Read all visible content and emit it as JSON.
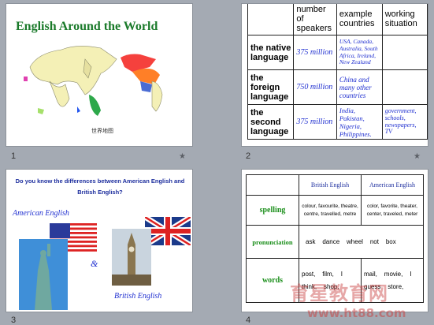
{
  "slides": [
    {
      "number": "1",
      "title": "English Around the World",
      "map_caption": "世界地图"
    },
    {
      "number": "2",
      "headers": [
        "",
        "number of speakers",
        "example countries",
        "working situation"
      ],
      "rows": [
        {
          "label": "the native language",
          "speakers": "375 million",
          "countries": "USA, Canada, Australia, South Africa, Ireland, New Zealand",
          "situation": ""
        },
        {
          "label": "the foreign language",
          "speakers": "750 million",
          "countries": "China and many other countries",
          "situation": ""
        },
        {
          "label": "the second language",
          "speakers": "375 million",
          "countries": "India, Pakistan, Nigeria, Philippines.",
          "situation": "government, schools, newspapers, TV"
        }
      ]
    },
    {
      "number": "3",
      "question": "Do you know the differences between American English and British English?",
      "american_label": "American English",
      "british_label": "British English",
      "amp": "&"
    },
    {
      "number": "4",
      "headers": [
        "",
        "British English",
        "American English"
      ],
      "rows": [
        {
          "label": "spelling",
          "british": "colour, favourite, theatre, centre, travelled, metre",
          "american": "color, favorite, theater, center, traveled, meter"
        },
        {
          "label": "pronunciation",
          "british": "ask    dance    wheel    not    box",
          "american": ""
        },
        {
          "label": "words",
          "british": "post,    film,    I think,    shop,",
          "american": "mail,    movie,    I guess    store,"
        }
      ]
    }
  ],
  "watermark": {
    "line1": "育星教育网",
    "line2": "www.ht88.com"
  },
  "colors": {
    "title_green": "#1a7a2a",
    "blue_text": "#1f2fd0",
    "background": "#a4aab3"
  }
}
